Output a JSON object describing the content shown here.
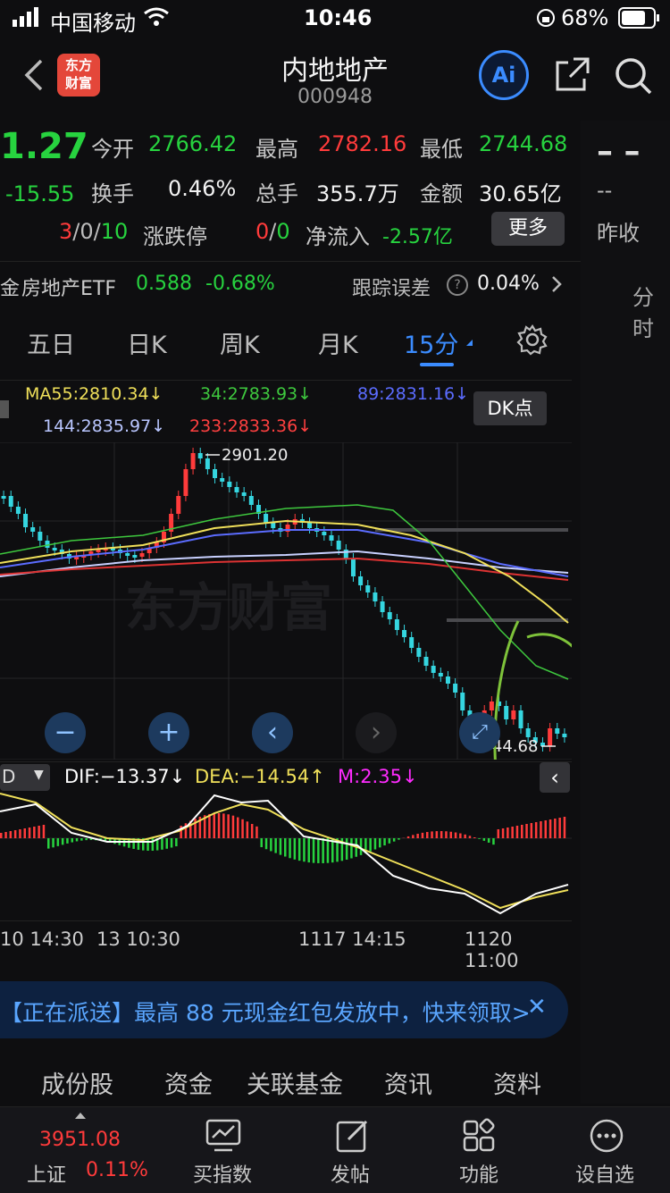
{
  "status": {
    "carrier": "中国移动",
    "time": "10:46",
    "battery": "68%"
  },
  "header": {
    "title": "内地地产",
    "code": "000948",
    "logo_line1": "东方",
    "logo_line2": "财富",
    "ai_label": "Ai"
  },
  "quote": {
    "price": "1.27",
    "change": "-15.55",
    "limit_counts": {
      "up": "3",
      "flat": "0",
      "down": "10",
      "label": "涨跌停"
    },
    "limit_stop": {
      "up": "0",
      "down": "0"
    },
    "open_label": "今开",
    "open": "2766.42",
    "high_label": "最高",
    "high": "2782.16",
    "low_label": "最低",
    "low": "2744.68",
    "turnover_label": "换手",
    "turnover": "0.46%",
    "volume_label": "总手",
    "volume": "355.7万",
    "amount_label": "金额",
    "amount": "30.65亿",
    "netflow_label": "净流入",
    "netflow": "-2.57亿",
    "more_label": "更多",
    "right_dash1": "– –",
    "right_dash2": "--",
    "prev_close_label": "昨收"
  },
  "etf": {
    "prefix": "金",
    "name": "房地产ETF",
    "price": "0.588",
    "change": "-0.68%",
    "tracking_label": "跟踪误差",
    "tracking": "0.04%"
  },
  "right_tab": "分时",
  "tabs": [
    "五日",
    "日K",
    "周K",
    "月K",
    "15分"
  ],
  "ma_legend": {
    "ma55": "MA55:2810.34↓",
    "ma34": "34:2783.93↓",
    "ma89": "89:2831.16↓",
    "ma144": "144:2835.97↓",
    "ma233": "233:2833.36↓",
    "dk_label": "DK点"
  },
  "chart_marks": {
    "high_label": "2901.20",
    "low_label": "2744.68",
    "watermark": "东方财富"
  },
  "macd": {
    "selector": "D",
    "dif": "DIF:−13.37↓",
    "dea": "DEA:−14.54↑",
    "m": "M:2.35↓"
  },
  "xaxis": [
    "10 14:30",
    "13 10:30",
    "1117 14:15",
    "1120 11:00"
  ],
  "banner": {
    "text": "【正在派送】最高 88 元现金红包发放中，快来领取>"
  },
  "subtabs": [
    "成份股",
    "资金",
    "关联基金",
    "资讯",
    "资料"
  ],
  "bottom": {
    "index_value": "3951.08",
    "index_name": "上证",
    "index_change": "0.11%",
    "buy_label": "买指数",
    "post_label": "发帖",
    "func_label": "功能",
    "setting_label": "设自选"
  },
  "colors": {
    "up": "#ff3b3b",
    "down": "#27d33f",
    "accent": "#3b8cff"
  }
}
